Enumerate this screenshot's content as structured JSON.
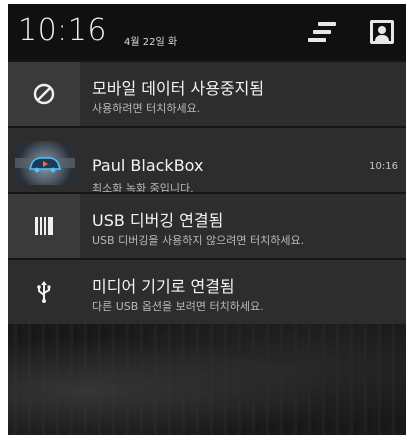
{
  "status_bar": {
    "time": "10:16",
    "date": "4월 22일 화"
  },
  "notifications": [
    {
      "icon": "block-icon",
      "title": "모바일 데이터 사용중지됨",
      "subtitle": "사용하려면 터치하세요."
    },
    {
      "icon": "paul-blackbox-app-icon",
      "title": "Paul BlackBox",
      "subtitle": "최소화 녹화 중입니다.",
      "time": "10:16",
      "highlight_color": "#e8581f"
    },
    {
      "icon": "usb-debug-icon",
      "title": "USB 디버깅 연결됨",
      "subtitle": "USB 디버깅을 사용하지 않으려면 터치하세요."
    },
    {
      "icon": "usb-icon",
      "title": "미디어 기기로 연결됨",
      "subtitle": "다른 USB 옵션을 보려면 터치하세요."
    }
  ],
  "colors": {
    "panel_bg": "#2d2d2d",
    "icon_bg": "#3a3a3a",
    "header_bg": "#101010",
    "accent": "#e8581f"
  }
}
